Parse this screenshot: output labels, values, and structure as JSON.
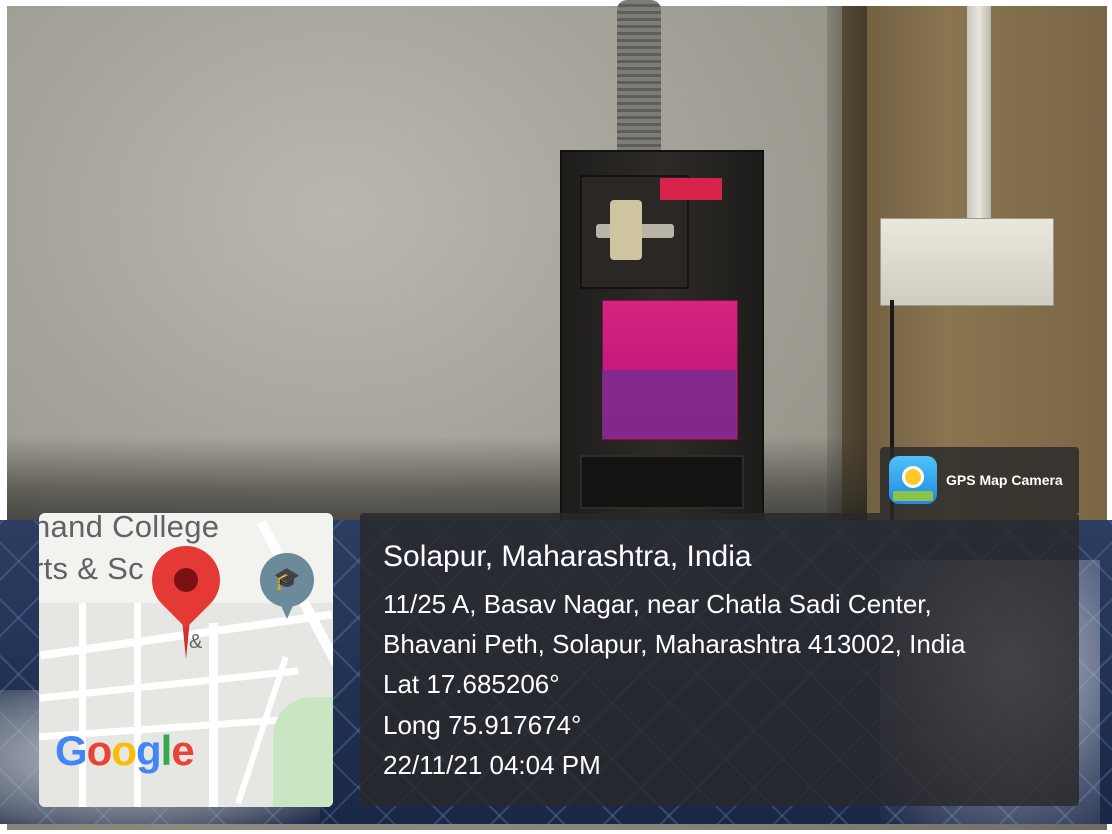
{
  "gps_app": {
    "label": "GPS Map Camera",
    "icon": "gps-map-camera-icon"
  },
  "map": {
    "line1": "nand College",
    "line2": "rts & Sc     ce",
    "amp": "&",
    "brand": [
      "G",
      "o",
      "o",
      "g",
      "l",
      "e"
    ],
    "brand_colors": [
      "#4285F4",
      "#EA4335",
      "#FBBC05",
      "#4285F4",
      "#34A853",
      "#EA4335"
    ],
    "pin_icon": "map-pin-icon",
    "poi_icon": "school-icon"
  },
  "location": {
    "title": "Solapur, Maharashtra, India",
    "address_line1": "11/25 A, Basav Nagar, near Chatla Sadi Center,",
    "address_line2": "Bhavani Peth, Solapur, Maharashtra 413002, India",
    "lat": "Lat 17.685206°",
    "long": "Long 75.917674°",
    "datetime": "22/11/21 04:04 PM"
  }
}
